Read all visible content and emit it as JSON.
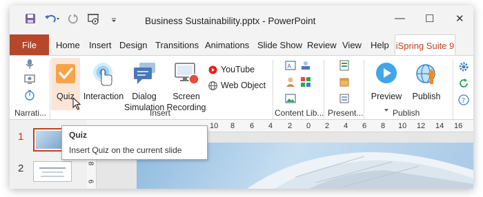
{
  "titlebar": {
    "doc_title": "Business Sustainability.pptx - PowerPoint",
    "qat": [
      {
        "icon": "save-icon"
      },
      {
        "icon": "undo-icon"
      },
      {
        "icon": "redo-icon"
      },
      {
        "icon": "present-icon"
      },
      {
        "icon": "customize-icon"
      }
    ],
    "window_controls": {
      "minimize": "—",
      "maximize": "☐",
      "close": "✕"
    }
  },
  "tabs": {
    "file": "File",
    "items": [
      "Home",
      "Insert",
      "Design",
      "Transitions",
      "Animations",
      "Slide Show",
      "Review",
      "View",
      "Help"
    ],
    "active": "iSpring Suite 9"
  },
  "ribbon": {
    "narration_group": "Narrati...",
    "insert": {
      "quiz": "Quiz",
      "interaction": "Interaction",
      "dialog_line1": "Dialog",
      "dialog_line2": "Simulation",
      "screen_line1": "Screen",
      "screen_line2": "Recording",
      "youtube": "YouTube",
      "web_object": "Web Object",
      "group_label": "Insert"
    },
    "content_library_group": "Content Lib...",
    "presenter_group": "Present...",
    "publish": {
      "preview": "Preview",
      "publish": "Publish",
      "group_label": "Publish"
    }
  },
  "colors": {
    "file_tab": "#b7472a",
    "active_tab_text": "#c43e1c",
    "quiz_highlight": "#fde5d6",
    "youtube_red": "#e62117",
    "preview_blue": "#42a5e8"
  },
  "slides": [
    {
      "number": "1",
      "selected": true
    },
    {
      "number": "2",
      "selected": false
    }
  ],
  "ruler": {
    "horizontal": [
      "10",
      "8",
      "6",
      "4",
      "2",
      "0",
      "2",
      "4",
      "6",
      "8",
      "10",
      "12",
      "14",
      "16"
    ],
    "vertical": [
      "8",
      "6"
    ]
  },
  "tooltip": {
    "title": "Quiz",
    "description": "Insert Quiz on the current slide"
  }
}
